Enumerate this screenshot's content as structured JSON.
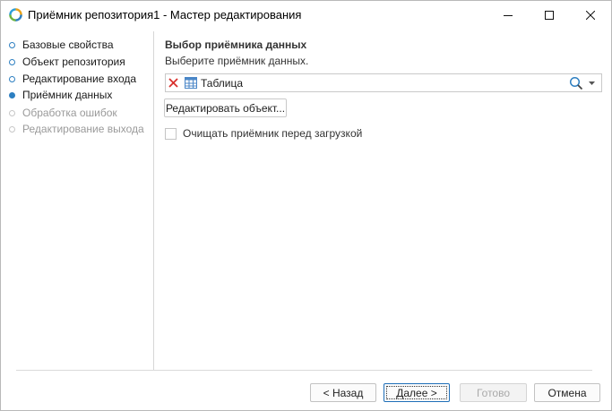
{
  "window": {
    "title": "Приёмник репозитория1 - Мастер редактирования",
    "icons": {
      "app": "app-logo-icon",
      "minimize": "minimize-icon",
      "maximize": "maximize-icon",
      "close": "close-icon"
    }
  },
  "nav": {
    "items": [
      {
        "label": "Базовые свойства",
        "state": "completed"
      },
      {
        "label": "Объект репозитория",
        "state": "completed"
      },
      {
        "label": "Редактирование входа",
        "state": "completed"
      },
      {
        "label": "Приёмник данных",
        "state": "active"
      },
      {
        "label": "Обработка ошибок",
        "state": "disabled"
      },
      {
        "label": "Редактирование выхода",
        "state": "disabled"
      }
    ]
  },
  "main": {
    "title": "Выбор приёмника данных",
    "subtitle": "Выберите приёмник данных.",
    "receiver": {
      "value": "Таблица",
      "icons": [
        "clear-icon",
        "table-icon",
        "search-icon",
        "dropdown-icon"
      ]
    },
    "edit_object_label": "Редактировать объект...",
    "clear_checkbox": {
      "label": "Очищать приёмник перед загрузкой",
      "checked": false
    }
  },
  "footer": {
    "back_label": "< Назад",
    "next_label": "Далее >",
    "done_label": "Готово",
    "cancel_label": "Отмена"
  },
  "colors": {
    "accent": "#2d7fc1",
    "clear_red": "#d9302c",
    "disabled_text": "#9a9a9a"
  }
}
